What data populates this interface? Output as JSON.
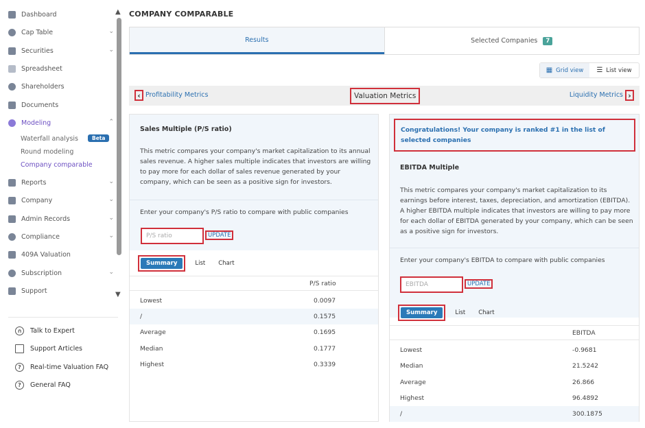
{
  "sidebar": {
    "items": [
      {
        "label": "Dashboard",
        "icon": "dashboard-icon",
        "expandable": false
      },
      {
        "label": "Cap Table",
        "icon": "pie-chart-icon",
        "expandable": true
      },
      {
        "label": "Securities",
        "icon": "document-icon",
        "expandable": true
      },
      {
        "label": "Spreadsheet",
        "icon": "spreadsheet-icon",
        "expandable": false
      },
      {
        "label": "Shareholders",
        "icon": "person-icon",
        "expandable": false
      },
      {
        "label": "Documents",
        "icon": "folder-icon",
        "expandable": false
      },
      {
        "label": "Modeling",
        "icon": "lightbulb-icon",
        "expandable": true,
        "active": true
      },
      {
        "label": "Reports",
        "icon": "report-icon",
        "expandable": true
      },
      {
        "label": "Company",
        "icon": "building-icon",
        "expandable": true
      },
      {
        "label": "Admin Records",
        "icon": "records-icon",
        "expandable": true
      },
      {
        "label": "Compliance",
        "icon": "shield-icon",
        "expandable": true
      },
      {
        "label": "409A Valuation",
        "icon": "valuation-icon",
        "expandable": false
      },
      {
        "label": "Subscription",
        "icon": "dollar-icon",
        "expandable": true
      },
      {
        "label": "Support",
        "icon": "support-icon",
        "expandable": false
      }
    ],
    "modeling_sub": [
      {
        "label": "Waterfall analysis",
        "badge": "Beta"
      },
      {
        "label": "Round modeling"
      },
      {
        "label": "Company comparable",
        "active": true
      }
    ],
    "help": [
      {
        "label": "Talk to Expert",
        "icon": "headset-icon"
      },
      {
        "label": "Support Articles",
        "icon": "book-icon"
      },
      {
        "label": "Real-time Valuation FAQ",
        "icon": "question-icon"
      },
      {
        "label": "General FAQ",
        "icon": "question-icon"
      }
    ]
  },
  "page": {
    "title": "COMPANY COMPARABLE",
    "tabs": [
      {
        "label": "Results",
        "active": true
      },
      {
        "label": "Selected Companies",
        "badge": "7"
      }
    ],
    "view_toggle": {
      "grid": "Grid view",
      "list": "List view"
    },
    "metrics_nav": {
      "prev": "Profitability Metrics",
      "current": "Valuation Metrics",
      "next": "Liquidity Metrics"
    }
  },
  "left_panel": {
    "title": "Sales Multiple (P/S ratio)",
    "description": "This metric compares your company's market capitalization to its annual sales revenue. A higher sales multiple indicates that investors are willing to pay more for each dollar of sales revenue generated by your company, which can be seen as a positive sign for investors.",
    "prompt": "Enter your company's P/S ratio to compare with public companies",
    "input_placeholder": "P/S ratio",
    "update_label": "UPDATE",
    "subtabs": {
      "summary": "Summary",
      "list": "List",
      "chart": "Chart"
    },
    "column_header": "P/S ratio",
    "rows": [
      {
        "label": "Lowest",
        "value": "0.0097"
      },
      {
        "label": "/",
        "value": "0.1575"
      },
      {
        "label": "Average",
        "value": "0.1695"
      },
      {
        "label": "Median",
        "value": "0.1777"
      },
      {
        "label": "Highest",
        "value": "0.3339"
      }
    ]
  },
  "right_panel": {
    "congrats": "Congratulations! Your company is ranked #1 in the list of selected companies",
    "title": "EBITDA Multiple",
    "description": "This metric compares your company's market capitalization to its earnings before interest, taxes, depreciation, and amortization (EBITDA). A higher EBITDA multiple indicates that investors are willing to pay more for each dollar of EBITDA generated by your company, which can be seen as a positive sign for investors.",
    "prompt": "Enter your company's EBITDA to compare with public companies",
    "input_placeholder": "EBITDA",
    "update_label": "UPDATE",
    "subtabs": {
      "summary": "Summary",
      "list": "List",
      "chart": "Chart"
    },
    "column_header": "EBITDA",
    "rows": [
      {
        "label": "Lowest",
        "value": "-0.9681"
      },
      {
        "label": "Median",
        "value": "21.5242"
      },
      {
        "label": "Average",
        "value": "26.866"
      },
      {
        "label": "Highest",
        "value": "96.4892"
      },
      {
        "label": "/",
        "value": "300.1875"
      }
    ]
  },
  "colors": {
    "accent": "#2a6fb0",
    "highlight": "#d02f3a",
    "active_nav": "#6c4fc2",
    "badge": "#4aa39a"
  }
}
